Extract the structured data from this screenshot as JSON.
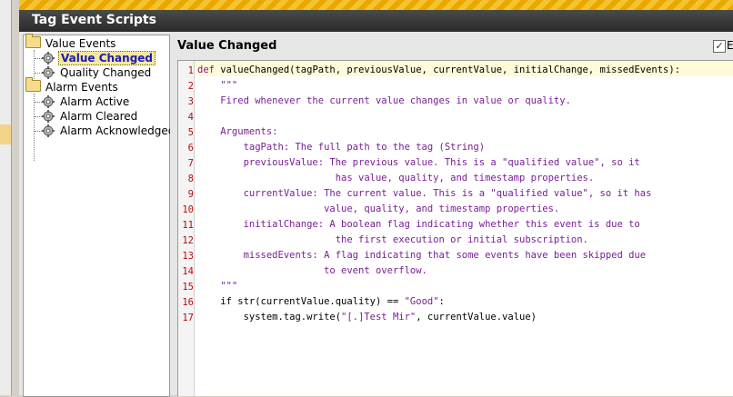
{
  "window": {
    "title": "Tag Event Scripts"
  },
  "tree": {
    "groups": [
      {
        "label": "Value Events",
        "items": [
          {
            "label": "Value Changed",
            "selected": true
          },
          {
            "label": "Quality Changed"
          }
        ]
      },
      {
        "label": "Alarm Events",
        "items": [
          {
            "label": "Alarm Active"
          },
          {
            "label": "Alarm Cleared"
          },
          {
            "label": "Alarm Acknowledged"
          }
        ]
      }
    ]
  },
  "panel": {
    "title": "Value Changed",
    "enabled_label": "E",
    "enabled_checked": true
  },
  "editor": {
    "lines": [
      {
        "n": "1",
        "tokens": [
          {
            "t": "def ",
            "c": "kw"
          },
          {
            "t": "valueChanged(tagPath, previousValue, currentValue, initialChange, missedEvents):",
            "c": "fn"
          }
        ]
      },
      {
        "n": "2",
        "tokens": [
          {
            "t": "    \"\"\"",
            "c": "doc"
          }
        ]
      },
      {
        "n": "3",
        "tokens": [
          {
            "t": "    Fired whenever the current value changes in value or quality.",
            "c": "doc"
          }
        ]
      },
      {
        "n": "4",
        "tokens": [
          {
            "t": "",
            "c": "doc"
          }
        ]
      },
      {
        "n": "5",
        "tokens": [
          {
            "t": "    Arguments:",
            "c": "doc"
          }
        ]
      },
      {
        "n": "6",
        "tokens": [
          {
            "t": "        tagPath: The full path to the tag (String)",
            "c": "doc"
          }
        ]
      },
      {
        "n": "7",
        "tokens": [
          {
            "t": "        previousValue: The previous value. This is a \"qualified value\", so it",
            "c": "doc"
          }
        ]
      },
      {
        "n": "8",
        "tokens": [
          {
            "t": "                        has value, quality, and timestamp properties.",
            "c": "doc"
          }
        ]
      },
      {
        "n": "9",
        "tokens": [
          {
            "t": "        currentValue: The current value. This is a \"qualified value\", so it has",
            "c": "doc"
          }
        ]
      },
      {
        "n": "10",
        "tokens": [
          {
            "t": "                      value, quality, and timestamp properties.",
            "c": "doc"
          }
        ]
      },
      {
        "n": "11",
        "tokens": [
          {
            "t": "        initialChange: A boolean flag indicating whether this event is due to",
            "c": "doc"
          }
        ]
      },
      {
        "n": "12",
        "tokens": [
          {
            "t": "                        the first execution or initial subscription.",
            "c": "doc"
          }
        ]
      },
      {
        "n": "13",
        "tokens": [
          {
            "t": "        missedEvents: A flag indicating that some events have been skipped due",
            "c": "doc"
          }
        ]
      },
      {
        "n": "14",
        "tokens": [
          {
            "t": "                      to event overflow.",
            "c": "doc"
          }
        ]
      },
      {
        "n": "15",
        "tokens": [
          {
            "t": "    \"\"\"",
            "c": "doc"
          }
        ]
      },
      {
        "n": "16",
        "tokens": [
          {
            "t": "    if ",
            "c": "plain"
          },
          {
            "t": "str",
            "c": "plain"
          },
          {
            "t": "(currentValue.quality) == ",
            "c": "plain"
          },
          {
            "t": "\"Good\"",
            "c": "str"
          },
          {
            "t": ":",
            "c": "plain"
          }
        ]
      },
      {
        "n": "17",
        "tokens": [
          {
            "t": "        system.tag.write(",
            "c": "plain"
          },
          {
            "t": "\"[.]Test Mir\"",
            "c": "str"
          },
          {
            "t": ", currentValue.value)",
            "c": "plain"
          }
        ]
      }
    ]
  },
  "colors": {
    "title_bar": "#2b2b2b",
    "stripe": "#f4c430",
    "selection": "#f5e7a3",
    "line_numbers": "#b01010",
    "docstring": "#7a1e96"
  }
}
